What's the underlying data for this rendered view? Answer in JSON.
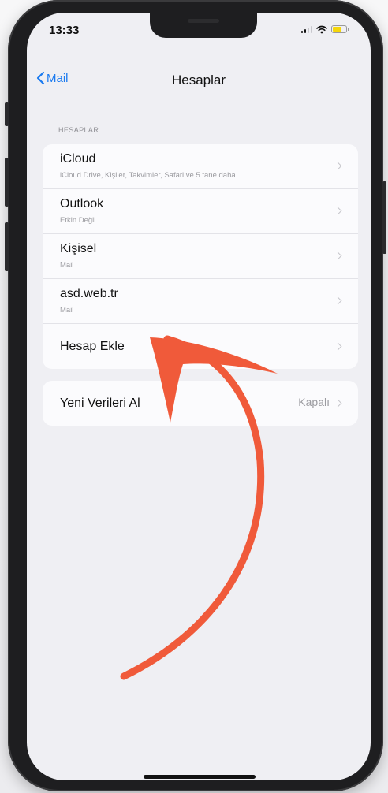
{
  "status_bar": {
    "time": "13:33"
  },
  "nav": {
    "back_label": "Mail",
    "title": "Hesaplar"
  },
  "section": {
    "header": "HESAPLAR"
  },
  "accounts": [
    {
      "title": "iCloud",
      "subtitle": "iCloud Drive, Kişiler, Takvimler, Safari ve 5 tane daha..."
    },
    {
      "title": "Outlook",
      "subtitle": "Etkin Değil"
    },
    {
      "title": "Kişisel",
      "subtitle": "Mail"
    },
    {
      "title": "asd.web.tr",
      "subtitle": "Mail"
    },
    {
      "title": "Hesap Ekle",
      "subtitle": ""
    }
  ],
  "fetch": {
    "label": "Yeni Verileri Al",
    "value": "Kapalı"
  },
  "colors": {
    "accent": "#1a7af0",
    "annotation_arrow": "#f05a3a",
    "battery": "#f5d60a"
  },
  "icons": {
    "back": "chevron-left-icon",
    "row": "chevron-right-icon",
    "wifi": "wifi-icon",
    "signal": "signal-icon",
    "battery": "battery-icon"
  }
}
